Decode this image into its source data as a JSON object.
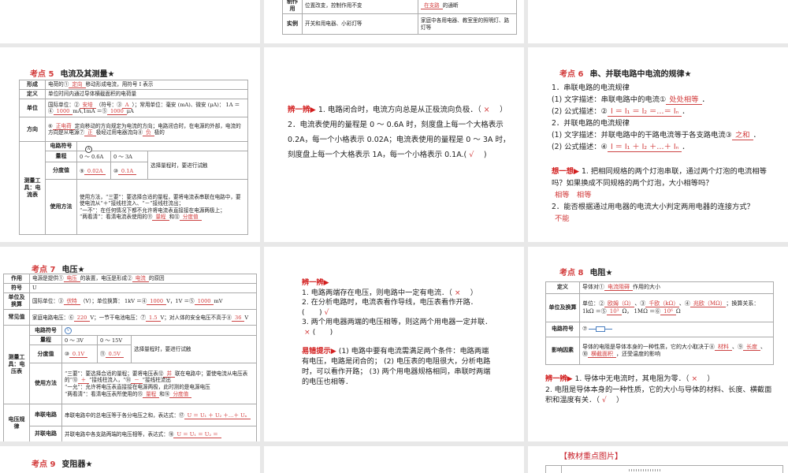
{
  "switch_table": {
    "rows": [
      {
        "label": "制作用",
        "c1": [
          "位置改变，控制作用不变"
        ],
        "c2": [
          {
            "a": "在支路"
          },
          "的通断"
        ]
      },
      {
        "label": "实例",
        "c1": [
          "开关和用电器、小彩灯等"
        ],
        "c2": [
          "家庭中各用电器、教室里的照明灯、路灯等"
        ]
      }
    ]
  },
  "s5": {
    "num": "考点 5",
    "title": "电流及其测量★",
    "r1_label": "形成",
    "r1": [
      "电荷的①",
      {
        "a": "定向"
      },
      "移动形成电流，用符号 I 表示"
    ],
    "r2_label": "定义",
    "r2": [
      "单位时间内通过导体横截面积的电荷量"
    ],
    "r3_label": "单位",
    "r3": [
      "国际单位：②",
      {
        "a": "安培"
      },
      "（符号：③",
      {
        "a": "A"
      },
      "）；常用单位：毫安 (mA)、微安 (μA)： 1A ＝④",
      {
        "a": "1000"
      },
      "mA,1mA ＝⑤",
      {
        "a": "1000"
      },
      "μA"
    ],
    "r4_label": "方向",
    "r4": [
      "⑥",
      {
        "a": "正电荷"
      },
      "定向移动的方向规定为电流的方向；电路闭合时，在电源的外部，电流的方向是从电源⑦",
      {
        "a": "正"
      },
      "极经过用电器流向⑧",
      {
        "a": "负"
      },
      "极的"
    ],
    "tool_label": "测量工具：电流表",
    "sym_label": "电路符号",
    "sym": "A",
    "range_label": "量程",
    "range1": "0 ～ 0.6A",
    "range2": "0 ～ 3A",
    "div_label": "分度值",
    "div1": [
      "⑨",
      {
        "a": "0.02A"
      }
    ],
    "div2": [
      "⑩",
      {
        "a": "0.1A"
      }
    ],
    "note": "选择量程时，要进行试触",
    "use_label": "使用方法",
    "use": [
      "使用方法，“三要”：要选择合适的量程，要将电流表串联在电路中，要使电流从“＋”接线柱流入、“－”接线柱流出；\n“一不”：在任何情况下都不允许将电流表直接接在电源两极上；\n“两看清”：看清电流表使用的⑪",
      {
        "a": "量程"
      },
      "和⑫",
      {
        "a": "分度值"
      }
    ]
  },
  "m2": {
    "tag": "辨一辨▶",
    "l1": [
      " 1. 电路闭合时，电流方向总是从正极流向负极．（",
      {
        "m": "×"
      },
      "　）"
    ],
    "l2": [
      "2．电流表使用的量程是 0 ～ 0.6A 时，刻度盘上每一个大格表示 0.2A，每一个小格表示 0.02A；电流表使用的量程是 0 ～ 3A 时，刻度盘上每一个大格表示 1A，每一个小格表示 0.1A.(",
      {
        "m": "√"
      },
      "　)"
    ]
  },
  "s6": {
    "num": "考点 6",
    "title": "串、并联电路中电流的规律★",
    "lines": [
      [
        "1．串联电路的电流规律"
      ],
      [
        "(1) 文字描述：串联电路中的电流①",
        {
          "a": "处处相等"
        },
        "．"
      ],
      [
        "(2) 公式描述：②",
        {
          "a": "I ＝ I₁ ＝ I₂ ＝…＝ Iₙ"
        },
        "．"
      ],
      [
        "2．并联电路的电流规律"
      ],
      [
        "(1) 文字描述：并联电路中的干路电流等于各支路电流③",
        {
          "a": "之和"
        },
        "．"
      ],
      [
        "(2) 公式描述：④",
        {
          "a": "I ＝ I₁ ＋ I₂ ＋…＋ Iₙ"
        },
        "．"
      ]
    ],
    "tag": "想一想▶",
    "q1": " 1. 把相同规格的两个灯泡串联，通过两个灯泡的电流相等吗？如果换成不同规格的两个灯泡，大小相等吗？",
    "a1": "相等　相等",
    "q2": "2．能否根据通过用电器的电流大小判定两用电器的连接方式？",
    "a2": "不能"
  },
  "s7": {
    "num": "考点 7",
    "title": "电压★",
    "r1_label": "作用",
    "r1": [
      "电源是提供①",
      {
        "a": "电压"
      },
      "的装置，电压是形成②",
      {
        "a": "电流"
      },
      "的原因"
    ],
    "r2_label": "符号",
    "r2": [
      "U"
    ],
    "r3_label": "单位及换算",
    "r3": [
      "国际单位：③",
      {
        "a": "伏特"
      },
      "（V）；单位换算： 1kV ＝④",
      {
        "a": "1000"
      },
      "V，1V ＝⑤",
      {
        "a": "1000"
      },
      "mV"
    ],
    "r4_label": "常见值",
    "r4": [
      "家庭电路电压：⑥",
      {
        "a": "220"
      },
      "V；一节干电池电压：⑦",
      {
        "a": "1.5"
      },
      "V；对人体的安全电压不高于⑧",
      {
        "a": "36"
      },
      "V"
    ],
    "tool_label": "测量工具：电压表",
    "sym_label": "电路符号",
    "sym": "V",
    "range_label": "量程",
    "range1": "0 ～ 3V",
    "range2": "0 ～ 15V",
    "div_label": "分度值",
    "div1": [
      "⑩",
      {
        "a": "0.1V"
      }
    ],
    "div2": [
      "⑪",
      {
        "a": "0.5V"
      }
    ],
    "note": "选择量程时，要进行试触",
    "use_label": "使用方法",
    "use": [
      "“三要”：要选择合适的量程；要将电压表⑫",
      {
        "a": "并"
      },
      "联在电路中；要使电流从电压表的“⑬",
      {
        "a": "＋"
      },
      "”接线柱流入，“⑭",
      {
        "a": "－"
      },
      "”接线柱流出\n“一允”：允许将电压表直接接在电源两极，此时测的是电源电压\n“两看清”：看清电压表所使用的⑮",
      {
        "a": "量程"
      },
      "和⑯",
      {
        "a": "分度值"
      }
    ],
    "law_label": "电压规律",
    "series_label": "串联电路",
    "series": [
      "串联电路中的总电压等于各分电压之和，表达式：⑰",
      {
        "a": "U ＝ U₁ ＋ U₂ ＋…＋ Uₙ"
      }
    ],
    "parallel_label": "并联电路",
    "parallel": [
      "并联电路中各支路两端的电压相等，表达式：⑱",
      {
        "a": "U ＝ U₁ ＝ U₂ ＝"
      }
    ]
  },
  "m3": {
    "tag": "辨一辨▶",
    "l1": [
      "1. 电路两端存在电压，则电路中一定有电流．（",
      {
        "m": "×"
      },
      "　）"
    ],
    "l2": [
      "2. 在分析电路时，电流表看作导线，电压表看作开路．(　　)",
      {
        "m": "√"
      }
    ],
    "l3": [
      "3. 两个用电器两端的电压相等，则这两个用电器一定并联．",
      {
        "m": "×"
      },
      "(　　)"
    ],
    "tag2": "易错提示▶",
    "tip": " (1) 电路中要有电流需满足两个条件：电路两端有电压，电路是闭合的； (2) 电压表的电阻很大，分析电路时，可以看作开路； (3) 两个用电器规格相同，串联时两端的电压也相等．"
  },
  "s8": {
    "num": "考点 8",
    "title": "电阻★",
    "r1_label": "定义",
    "r1": [
      "导体对①",
      {
        "a": "电流阻碍"
      },
      "作用的大小"
    ],
    "r2_label": "单位及换算",
    "r2": [
      "单位：②",
      {
        "a": "欧姆（Ω）"
      },
      "、③",
      {
        "a": "千欧（kΩ）"
      },
      "、④",
      {
        "a": "兆欧（MΩ）"
      },
      "；换算关系： 1kΩ ＝⑤",
      {
        "a": "10³"
      },
      "Ω， 1MΩ ＝⑥",
      {
        "a": "10⁶"
      },
      "Ω"
    ],
    "r3_label": "电路符号",
    "r3": [
      "⑦"
    ],
    "r4_label": "影响因素",
    "r4": [
      "导体的电阻是导体本身的一种性质，它的大小取决于⑧",
      {
        "a": "材料"
      },
      "、⑨",
      {
        "a": "长度"
      },
      "、⑩",
      {
        "a": "横截面积"
      },
      "，还受温度的影响"
    ],
    "tag": "辨一辨▶",
    "l1": [
      " 1. 导体中无电流时，其电阻为零．（",
      {
        "m": "×"
      },
      "　）"
    ],
    "l2": [
      "2. 电阻是导体本身的一种性质，它的大小与导体的材料、长度、横截面积和温度有关．（",
      {
        "m": "√"
      },
      "　）"
    ]
  },
  "s9": {
    "num": "考点 9",
    "title": "变阻器★"
  },
  "s10": {
    "title": "【教材重点图片】"
  }
}
